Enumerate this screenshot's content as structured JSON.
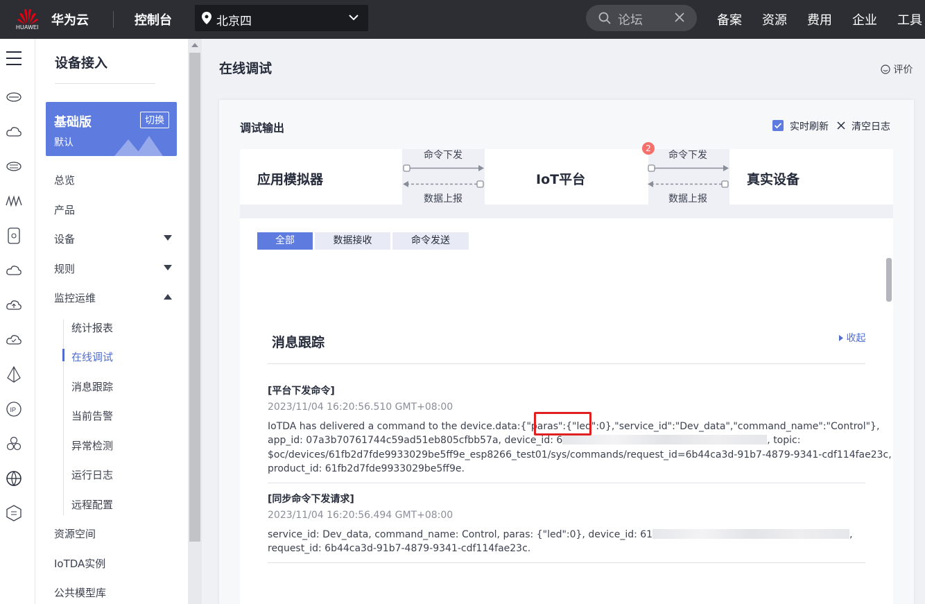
{
  "topbar": {
    "logo_text": "HUAWEI",
    "brand": "华为云",
    "console": "控制台",
    "region": "北京四",
    "search_placeholder": "论坛",
    "nav": [
      "备案",
      "资源",
      "费用",
      "企业",
      "工具"
    ]
  },
  "menu": {
    "title": "设备接入",
    "edition": {
      "name": "基础版",
      "sub": "默认",
      "switch_label": "切换"
    },
    "items": {
      "overview": "总览",
      "product": "产品",
      "device": "设备",
      "rules": "规则",
      "ops": "监控运维",
      "resource_space": "资源空间",
      "iotda_instance": "IoTDA实例",
      "model_lib": "公共模型库"
    },
    "ops_children": [
      "统计报表",
      "在线调试",
      "消息跟踪",
      "当前告警",
      "异常检测",
      "运行日志",
      "远程配置"
    ]
  },
  "main": {
    "title": "在线调试",
    "rate_label": "评价",
    "panel_title": "调试输出",
    "realtime_label": "实时刷新",
    "clear_label": "清空日志",
    "flow": {
      "app_sim": "应用模拟器",
      "iot_platform": "IoT平台",
      "real_device": "真实设备",
      "cmd_down": "命令下发",
      "data_up": "数据上报",
      "badge": "2"
    },
    "filters": [
      "全部",
      "数据接收",
      "命令发送"
    ],
    "trace": {
      "title": "消息跟踪",
      "collapse": "收起",
      "entries": [
        {
          "title": "[平台下发命令]",
          "time": "2023/11/04 16:20:56.510 GMT+08:00",
          "line1": "IoTDA has delivered a command to the device.data:{\"paras\":{\"led\":0},\"service_id\":\"Dev_data\",\"command_name\":\"Control\"},",
          "line2a": "app_id: 07a3b70761744c59ad51eb805cfbb57a, device_id: 6",
          "line2b": ", topic:",
          "line3": "$oc/devices/61fb2d7fde9933029be5ff9e_esp8266_test01/sys/commands/request_id=6b44ca3d-91b7-4879-9341-cdf114fae23c,",
          "line4": "product_id: 61fb2d7fde9933029be5ff9e."
        },
        {
          "title": "[同步命令下发请求]",
          "time": "2023/11/04 16:20:56.494 GMT+08:00",
          "line1a": "service_id: Dev_data, command_name: Control, paras: {\"led\":0}, device_id: 61",
          "line1b": ",",
          "line2": "request_id: 6b44ca3d-91b7-4879-9341-cdf114fae23c."
        }
      ]
    }
  },
  "colors": {
    "accent": "#5e7ce0",
    "topbar": "#2c2e33",
    "highlight": "#e02020",
    "badge": "#f66f6a"
  }
}
